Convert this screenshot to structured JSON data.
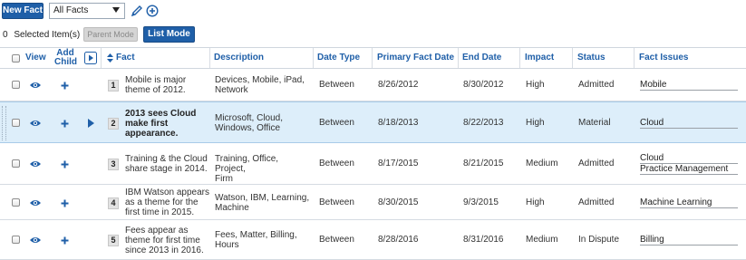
{
  "toolbar": {
    "new_fact_label": "New Fact",
    "filter_selected": "All Facts",
    "selected_count": "0",
    "selected_label": "Selected Item(s)",
    "parent_mode_label": "Parent Mode",
    "list_mode_label": "List Mode"
  },
  "columns": {
    "view": "View",
    "add_child_1": "Add",
    "add_child_2": "Child",
    "fact": "Fact",
    "description": "Description",
    "date_type": "Date Type",
    "primary_fact_date": "Primary Fact Date",
    "end_date": "End Date",
    "impact": "Impact",
    "status": "Status",
    "fact_issues": "Fact Issues"
  },
  "rows": [
    {
      "num": "1",
      "fact_lines": [
        "Mobile is major",
        "theme of 2012."
      ],
      "desc_lines": [
        "Devices, Mobile, iPad,",
        "Network"
      ],
      "date_type": "Between",
      "primary_date": "8/26/2012",
      "end_date": "8/30/2012",
      "impact": "High",
      "status": "Admitted",
      "issues": [
        "Mobile"
      ]
    },
    {
      "num": "2",
      "fact_lines": [
        "2013 sees Cloud",
        "make first",
        "appearance."
      ],
      "desc_lines": [
        "Microsoft, Cloud,",
        "Windows, Office"
      ],
      "date_type": "Between",
      "primary_date": "8/18/2013",
      "end_date": "8/22/2013",
      "impact": "High",
      "status": "Material",
      "issues": [
        "Cloud"
      ]
    },
    {
      "num": "3",
      "fact_lines": [
        "Training & the Cloud",
        "share stage in 2014."
      ],
      "desc_lines": [
        "Training, Office, Project,",
        "Firm"
      ],
      "date_type": "Between",
      "primary_date": "8/17/2015",
      "end_date": "8/21/2015",
      "impact": "Medium",
      "status": "Admitted",
      "issues": [
        "Cloud",
        "Practice Management"
      ]
    },
    {
      "num": "4",
      "fact_lines": [
        "IBM Watson appears",
        "as a theme for the",
        "first time in 2015."
      ],
      "desc_lines": [
        "Watson, IBM, Learning,",
        "Machine"
      ],
      "date_type": "Between",
      "primary_date": "8/30/2015",
      "end_date": "9/3/2015",
      "impact": "High",
      "status": "Admitted",
      "issues": [
        "Machine Learning"
      ]
    },
    {
      "num": "5",
      "fact_lines": [
        "Fees appear as",
        "theme for first time",
        "since 2013 in 2016."
      ],
      "desc_lines": [
        "Fees, Matter, Billing,",
        "Hours"
      ],
      "date_type": "Between",
      "primary_date": "8/28/2016",
      "end_date": "8/31/2016",
      "impact": "Medium",
      "status": "In Dispute",
      "issues": [
        "Billing"
      ]
    }
  ],
  "selected_row": "2",
  "colors": {
    "accent": "#1f5fa8",
    "selected_row_bg": "#ddeefa"
  },
  "icons": [
    "pencil-icon",
    "add-circle-icon",
    "eye-icon",
    "plus-icon",
    "expand-arrow-icon",
    "sort-icon",
    "dropdown-caret-icon"
  ]
}
